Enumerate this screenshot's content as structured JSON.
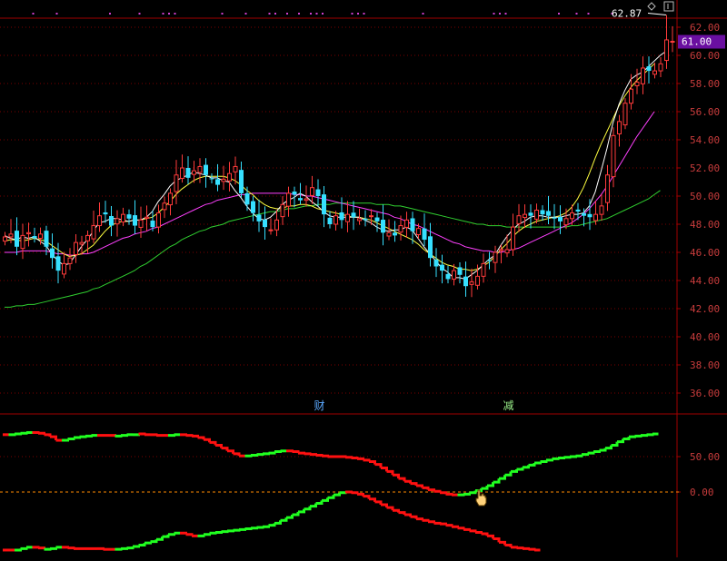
{
  "colors": {
    "background": "#000000",
    "grid": "#7a0000",
    "axis_line": "#a00000",
    "axis_text": "#c83c3c",
    "candle_up": "#ff3b3b",
    "candle_down": "#36e0ff",
    "ma_short": "#ffffff",
    "ma_mid": "#ffff40",
    "ma_long": "#ff40ff",
    "ma_longest": "#30d030",
    "osc_red": "#ff1010",
    "osc_green": "#20ff20",
    "zero_line": "#ff8a00",
    "price_tag_bg": "#6a0fa0",
    "marker": "#d040d0",
    "label_blue": "#5aa8ff",
    "label_green": "#9af08a"
  },
  "price_panel": {
    "axis_ticks": [
      "62.00",
      "60.00",
      "58.00",
      "56.00",
      "54.00",
      "52.00",
      "50.00",
      "48.00",
      "46.00",
      "44.00",
      "42.00",
      "40.00",
      "38.00",
      "36.00"
    ],
    "current_price": "61.00",
    "high_annotation": "62.87",
    "event_labels": [
      {
        "text": "财",
        "bar": 53
      },
      {
        "text": "减",
        "bar": 85
      }
    ]
  },
  "osc_panel": {
    "axis_ticks": [
      "50.00",
      "0.00"
    ]
  },
  "chart_data": [
    {
      "type": "candlestick",
      "ylim": [
        35,
        63
      ],
      "high_mark": 62.87,
      "last_price": 61.0,
      "close": [
        47.1,
        47.3,
        46.4,
        47.2,
        47.4,
        47.0,
        47.3,
        46.4,
        45.6,
        44.7,
        45.2,
        45.6,
        46.7,
        46.7,
        47.2,
        47.9,
        48.6,
        48.7,
        47.9,
        48.4,
        48.7,
        48.4,
        47.9,
        48.3,
        48.5,
        47.8,
        48.8,
        49.5,
        50.2,
        51.5,
        52.0,
        51.3,
        51.8,
        52.1,
        51.5,
        51.2,
        50.8,
        51.2,
        51.6,
        52.1,
        50.2,
        49.4,
        48.8,
        48.2,
        47.8,
        47.6,
        48.3,
        49.4,
        50.2,
        50.1,
        49.7,
        49.8,
        50.6,
        50.0,
        48.7,
        48.0,
        48.6,
        48.3,
        48.7,
        48.5,
        48.4,
        48.3,
        48.6,
        48.2,
        47.4,
        47.4,
        47.2,
        47.9,
        48.3,
        47.5,
        47.7,
        46.9,
        45.6,
        45.0,
        44.7,
        44.1,
        44.7,
        44.4,
        43.6,
        43.9,
        44.3,
        45.2,
        45.4,
        46.0,
        46.2,
        46.2,
        47.8,
        48.6,
        48.7,
        48.6,
        49.0,
        48.7,
        48.6,
        48.4,
        48.2,
        48.4,
        48.8,
        48.9,
        48.6,
        48.5,
        48.7,
        49.3,
        51.5,
        54.3,
        55.3,
        56.6,
        57.6,
        58.1,
        59.1,
        58.9,
        58.9,
        59.4,
        61.1,
        61.0
      ],
      "ma_short": [
        47.2,
        47.0,
        46.9,
        47.1,
        47.0,
        47.1,
        46.8,
        46.5,
        45.9,
        45.4,
        45.1,
        45.2,
        45.8,
        46.4,
        46.9,
        47.5,
        48.1,
        48.2,
        48.4,
        48.4,
        48.3,
        48.2,
        48.3,
        48.3,
        48.5,
        48.9,
        49.6,
        50.1,
        50.7,
        51.1,
        51.3,
        51.5,
        51.7,
        51.6,
        51.5,
        51.3,
        51.3,
        51.1,
        51.0,
        50.4,
        49.9,
        49.3,
        48.8,
        48.4,
        48.3,
        48.5,
        48.9,
        49.4,
        49.7,
        49.9,
        50.2,
        50.0,
        49.6,
        49.3,
        48.9,
        48.6,
        48.5,
        48.5,
        48.5,
        48.5,
        48.5,
        48.3,
        48.1,
        47.8,
        47.6,
        47.5,
        47.6,
        47.6,
        47.8,
        47.6,
        47.0,
        46.4,
        45.9,
        45.4,
        44.9,
        44.6,
        44.2,
        44.2,
        44.1,
        44.4,
        44.7,
        45.1,
        45.5,
        45.8,
        46.5,
        47.1,
        47.6,
        48.0,
        48.2,
        48.5,
        48.6,
        48.6,
        48.5,
        48.5,
        48.5,
        48.6,
        48.7,
        48.7,
        48.8,
        49.3,
        50.3,
        51.8,
        53.4,
        55.2,
        56.5,
        57.5,
        58.3,
        58.6,
        58.8,
        59.2,
        59.6,
        60.0,
        60.3
      ],
      "ma_mid": [
        46.8,
        46.9,
        46.9,
        46.8,
        46.9,
        47.0,
        46.9,
        46.8,
        46.5,
        46.2,
        45.9,
        45.7,
        45.8,
        45.9,
        46.2,
        46.5,
        47.0,
        47.5,
        47.9,
        48.1,
        48.2,
        48.2,
        48.3,
        48.3,
        48.4,
        48.5,
        48.8,
        49.2,
        49.6,
        50.1,
        50.5,
        50.8,
        51.1,
        51.3,
        51.4,
        51.4,
        51.4,
        51.4,
        51.3,
        51.1,
        50.8,
        50.4,
        50.1,
        49.7,
        49.4,
        49.2,
        49.1,
        49.1,
        49.3,
        49.3,
        49.4,
        49.4,
        49.3,
        49.1,
        49.0,
        48.9,
        48.8,
        48.7,
        48.6,
        48.5,
        48.5,
        48.4,
        48.3,
        48.1,
        47.9,
        47.7,
        47.5,
        47.3,
        47.1,
        46.9,
        46.6,
        46.2,
        45.9,
        45.6,
        45.3,
        45.1,
        45.0,
        44.8,
        44.8,
        44.7,
        44.8,
        45.0,
        45.3,
        45.7,
        46.2,
        46.6,
        47.1,
        47.5,
        47.8,
        48.0,
        48.2,
        48.3,
        48.4,
        48.5,
        48.6,
        48.8,
        49.2,
        49.8,
        50.6,
        51.6,
        52.7,
        53.7,
        54.6,
        55.5,
        56.4,
        57.1,
        57.7,
        58.2,
        58.6,
        59.0,
        59.4
      ],
      "ma_long": [
        46.0,
        46.0,
        46.0,
        46.1,
        46.1,
        46.1,
        46.1,
        46.1,
        46.0,
        45.9,
        45.9,
        45.8,
        45.8,
        45.9,
        45.9,
        46.0,
        46.2,
        46.4,
        46.6,
        46.8,
        47.0,
        47.1,
        47.3,
        47.4,
        47.5,
        47.7,
        47.8,
        48.0,
        48.2,
        48.4,
        48.6,
        48.8,
        49.0,
        49.2,
        49.4,
        49.5,
        49.7,
        49.8,
        49.9,
        50.0,
        50.1,
        50.1,
        50.2,
        50.2,
        50.2,
        50.2,
        50.2,
        50.2,
        50.2,
        50.1,
        50.1,
        50.0,
        50.0,
        49.9,
        49.8,
        49.7,
        49.6,
        49.5,
        49.4,
        49.3,
        49.2,
        49.1,
        49.0,
        48.9,
        48.8,
        48.7,
        48.5,
        48.4,
        48.2,
        48.0,
        47.9,
        47.7,
        47.5,
        47.3,
        47.1,
        46.9,
        46.7,
        46.6,
        46.4,
        46.3,
        46.2,
        46.1,
        46.1,
        46.0,
        46.0,
        46.1,
        46.2,
        46.3,
        46.5,
        46.7,
        46.9,
        47.1,
        47.3,
        47.5,
        47.7,
        47.9,
        48.1,
        48.4,
        48.7,
        49.1,
        49.6,
        50.1,
        50.7,
        51.4,
        52.1,
        52.8,
        53.5,
        54.2,
        54.8,
        55.4,
        56.0
      ],
      "ma_longest": [
        42.1,
        42.1,
        42.2,
        42.2,
        42.3,
        42.3,
        42.4,
        42.5,
        42.6,
        42.7,
        42.8,
        42.9,
        43.0,
        43.1,
        43.2,
        43.4,
        43.5,
        43.7,
        43.9,
        44.1,
        44.3,
        44.5,
        44.7,
        45.0,
        45.2,
        45.5,
        45.8,
        46.1,
        46.4,
        46.6,
        46.9,
        47.1,
        47.3,
        47.5,
        47.6,
        47.8,
        47.9,
        48.0,
        48.2,
        48.3,
        48.4,
        48.5,
        48.6,
        48.7,
        48.8,
        48.9,
        48.9,
        49.0,
        49.1,
        49.1,
        49.2,
        49.3,
        49.3,
        49.4,
        49.4,
        49.4,
        49.5,
        49.5,
        49.5,
        49.5,
        49.5,
        49.5,
        49.5,
        49.4,
        49.4,
        49.4,
        49.3,
        49.3,
        49.2,
        49.1,
        49.0,
        48.9,
        48.8,
        48.7,
        48.6,
        48.5,
        48.4,
        48.3,
        48.2,
        48.1,
        48.0,
        48.0,
        47.9,
        47.9,
        47.9,
        47.8,
        47.8,
        47.8,
        47.8,
        47.8,
        47.8,
        47.8,
        47.8,
        47.8,
        47.8,
        47.8,
        47.9,
        47.9,
        48.0,
        48.1,
        48.2,
        48.3,
        48.4,
        48.6,
        48.8,
        49.0,
        49.2,
        49.4,
        49.6,
        49.8,
        50.1,
        50.4
      ]
    },
    {
      "type": "step-line",
      "ylim": [
        -85,
        85
      ],
      "upper": [
        81,
        81,
        82,
        83,
        84,
        84,
        83,
        81,
        78,
        73,
        73,
        75,
        77,
        78,
        79,
        80,
        80,
        80,
        80,
        79,
        80,
        81,
        81,
        82,
        81,
        81,
        80,
        80,
        80,
        81,
        81,
        80,
        79,
        77,
        74,
        70,
        66,
        62,
        58,
        54,
        51,
        51,
        52,
        53,
        54,
        55,
        57,
        58,
        58,
        57,
        55,
        54,
        53,
        52,
        51,
        50,
        50,
        50,
        49,
        48,
        47,
        45,
        43,
        39,
        34,
        29,
        24,
        19,
        15,
        12,
        9,
        6,
        3,
        1,
        -1,
        -3,
        -4,
        -4,
        -3,
        -1,
        2,
        5,
        9,
        14,
        19,
        24,
        29,
        32,
        35,
        38,
        41,
        43,
        45,
        47,
        48,
        49,
        50,
        51,
        53,
        55,
        57,
        59,
        62,
        66,
        71,
        75,
        78,
        79,
        80,
        81,
        82,
        82
      ],
      "lower": [
        -82,
        -82,
        -82,
        -80,
        -78,
        -78,
        -79,
        -81,
        -80,
        -78,
        -78,
        -79,
        -80,
        -80,
        -80,
        -80,
        -80,
        -81,
        -81,
        -81,
        -80,
        -79,
        -77,
        -75,
        -72,
        -70,
        -67,
        -63,
        -60,
        -58,
        -58,
        -60,
        -62,
        -62,
        -60,
        -58,
        -57,
        -56,
        -55,
        -54,
        -53,
        -52,
        -51,
        -50,
        -49,
        -47,
        -44,
        -40,
        -36,
        -32,
        -28,
        -24,
        -20,
        -16,
        -12,
        -8,
        -4,
        -1,
        0,
        -1,
        -3,
        -6,
        -10,
        -14,
        -18,
        -22,
        -26,
        -29,
        -32,
        -35,
        -38,
        -40,
        -42,
        -44,
        -45,
        -47,
        -49,
        -51,
        -53,
        -55,
        -57,
        -59,
        -62,
        -66,
        -71,
        -75,
        -78,
        -79,
        -80,
        -81,
        -82,
        -82
      ]
    }
  ]
}
